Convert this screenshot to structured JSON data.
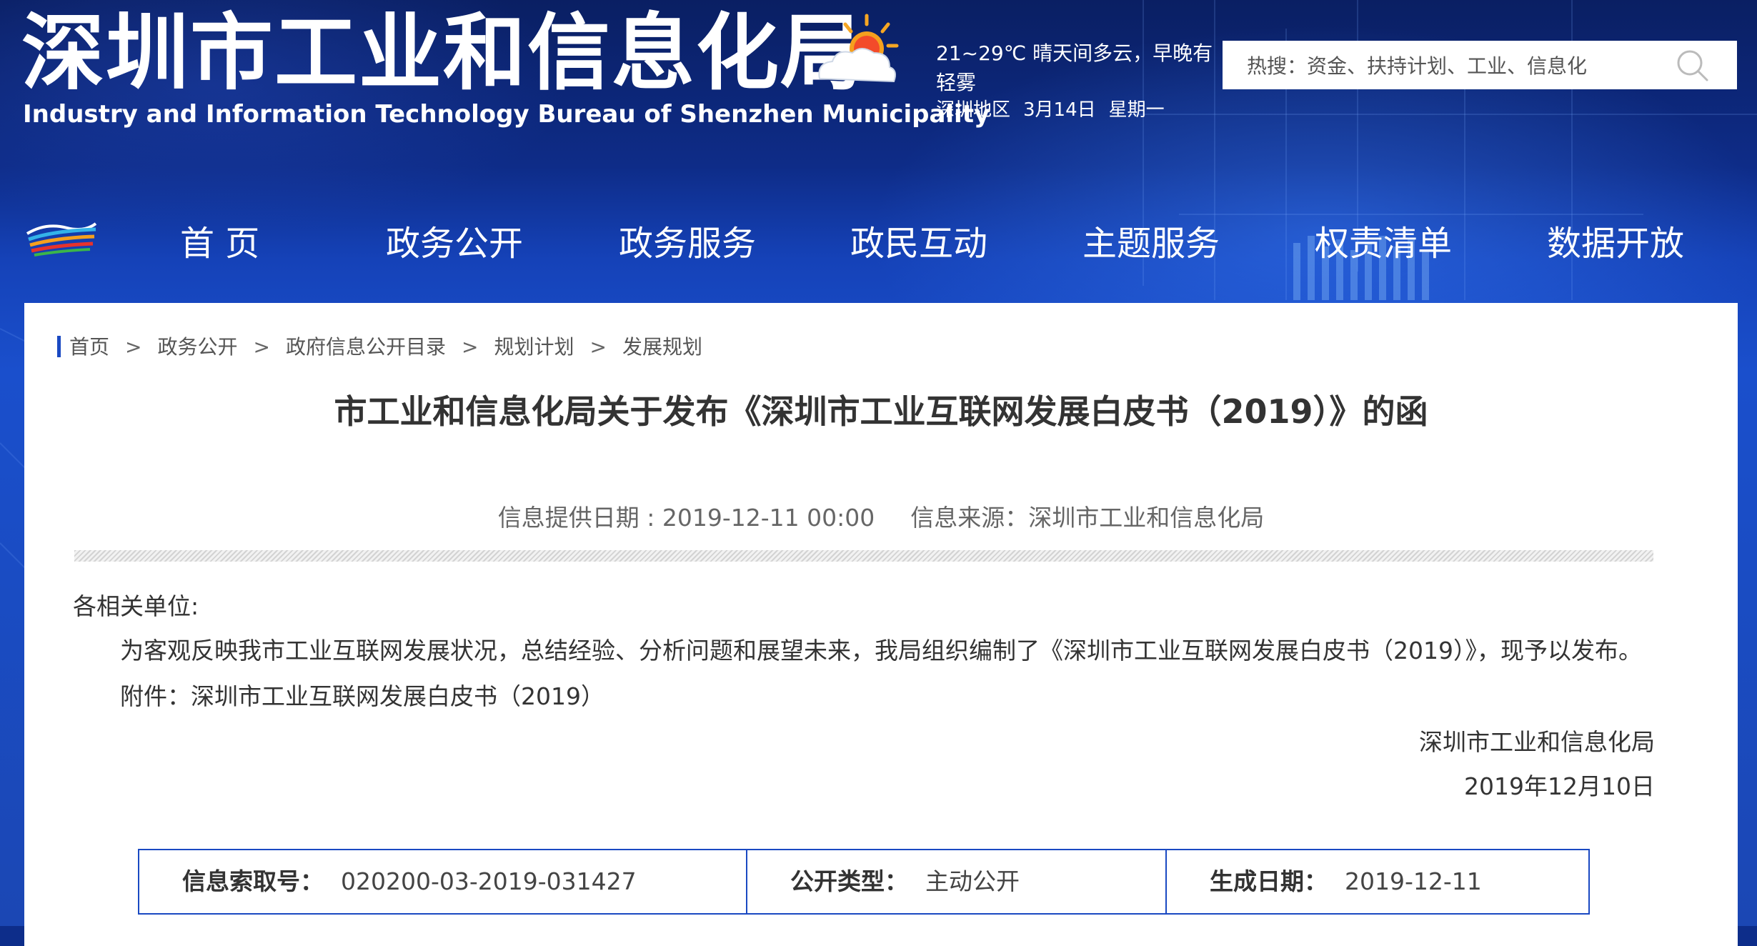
{
  "header": {
    "title": "深圳市工业和信息化局",
    "subtitle": "Industry and Information Technology Bureau of Shenzhen Municipality",
    "weather": {
      "line1": "21~29℃    晴天间多云，早晚有",
      "line2": "轻雾",
      "region": "深圳地区",
      "date": "3月14日",
      "weekday": "星期一",
      "icon": "sun-cloud-icon"
    },
    "search": {
      "placeholder": "热搜：资金、扶持计划、工业、信息化",
      "icon": "search-icon"
    }
  },
  "nav": {
    "items": [
      "首 页",
      "政务公开",
      "政务服务",
      "政民互动",
      "主题服务",
      "权责清单",
      "数据开放"
    ]
  },
  "breadcrumb": [
    "首页",
    "政务公开",
    "政府信息公开目录",
    "规划计划",
    "发展规划"
  ],
  "article": {
    "title": "市工业和信息化局关于发布《深圳市工业互联网发展白皮书（2019）》的函",
    "date_label": "信息提供日期 : ",
    "date_value": "2019-12-11 00:00",
    "source_label": "信息来源：",
    "source_value": "深圳市工业和信息化局",
    "salutation": "各相关单位:",
    "paragraph": "为客观反映我市工业互联网发展状况，总结经验、分析问题和展望未来，我局组织编制了《深圳市工业互联网发展白皮书（2019）》，现予以发布。",
    "attachment": "附件：深圳市工业互联网发展白皮书（2019）",
    "signature_org": "深圳市工业和信息化局",
    "signature_date": "2019年12月10日"
  },
  "info_table": {
    "index_label": "信息索取号：",
    "index_value": "020200-03-2019-031427",
    "type_label": "公开类型：",
    "type_value": "主动公开",
    "gen_label": "生成日期：",
    "gen_value": "2019-12-11"
  }
}
